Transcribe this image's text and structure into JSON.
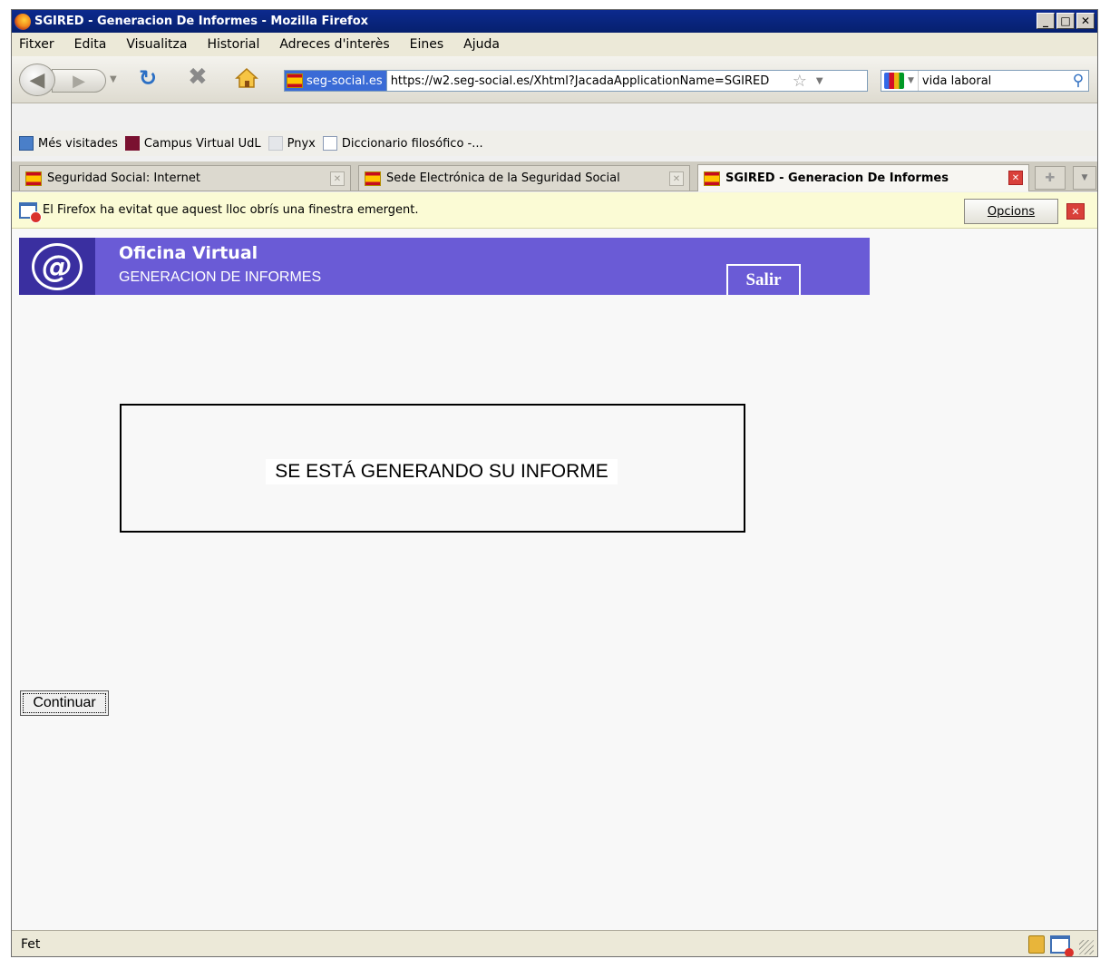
{
  "window": {
    "title": "SGIRED - Generacion De Informes - Mozilla Firefox",
    "minimize": "_",
    "maximize": "□",
    "close": "✕"
  },
  "menu": [
    "Fitxer",
    "Edita",
    "Visualitza",
    "Historial",
    "Adreces d'interès",
    "Eines",
    "Ajuda"
  ],
  "nav": {
    "site_identity": "seg-social.es",
    "url": "https://w2.seg-social.es/Xhtml?JacadaApplicationName=SGIRED",
    "search_value": "vida laboral"
  },
  "bookmarks": [
    "Més visitades",
    "Campus Virtual UdL",
    "Pnyx",
    "Diccionario filosófico -..."
  ],
  "tabs": [
    {
      "label": "Seguridad Social: Internet",
      "active": false
    },
    {
      "label": "Sede Electrónica de la Seguridad Social",
      "active": false
    },
    {
      "label": "SGIRED - Generacion De Informes",
      "active": true
    }
  ],
  "notification": {
    "message": "El Firefox ha evitat que aquest lloc obrís una finestra emergent.",
    "options_label": "Opcions"
  },
  "page": {
    "banner_title": "Oficina Virtual",
    "banner_subtitle": "GENERACION DE INFORMES",
    "salir_label": "Salir",
    "message": "SE ESTÁ GENERANDO SU INFORME",
    "continue_label": "Continuar"
  },
  "status": {
    "text": "Fet"
  }
}
